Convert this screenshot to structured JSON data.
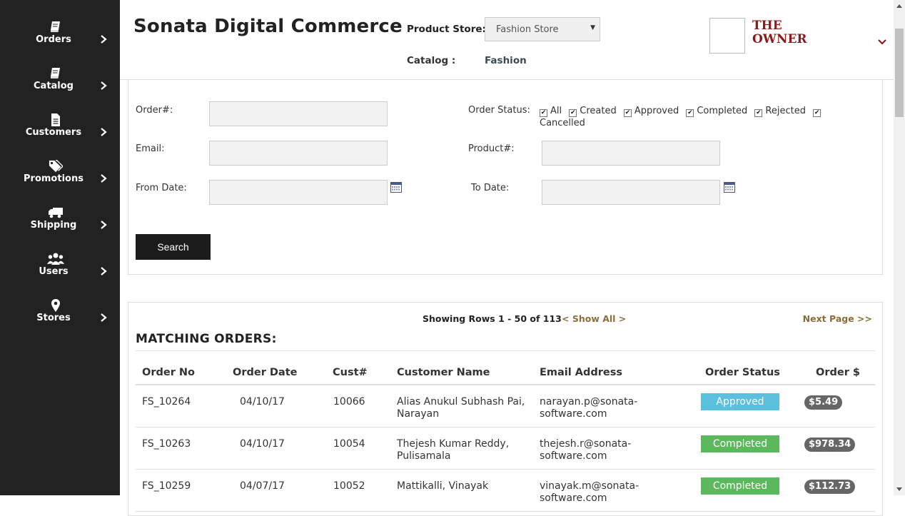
{
  "sidebar": {
    "items": [
      {
        "label": "Orders",
        "icon": "book-icon"
      },
      {
        "label": "Catalog",
        "icon": "book-icon"
      },
      {
        "label": "Customers",
        "icon": "document-icon"
      },
      {
        "label": "Promotions",
        "icon": "tags-icon"
      },
      {
        "label": "Shipping",
        "icon": "truck-icon"
      },
      {
        "label": "Users",
        "icon": "users-icon"
      },
      {
        "label": "Stores",
        "icon": "map-marker-icon"
      }
    ]
  },
  "header": {
    "brand": "Sonata Digital Commerce",
    "product_store_label": "Product Store:",
    "product_store_value": "Fashion Store",
    "catalog_label": "Catalog :",
    "catalog_value": "Fashion",
    "user_name": "THE OWNER"
  },
  "filter": {
    "order_label": "Order#:",
    "email_label": "Email:",
    "from_date_label": "From Date:",
    "order_status_label": "Order Status:",
    "product_label": "Product#:",
    "to_date_label": "To Date:",
    "statuses": [
      "All",
      "Created",
      "Approved",
      "Completed",
      "Rejected",
      "Cancelled"
    ],
    "search_label": "Search"
  },
  "orders": {
    "showing": "Showing Rows 1 - 50 of 113",
    "show_all": "< Show All >",
    "next_page": "Next Page >>",
    "title": "MATCHING ORDERS:",
    "columns": [
      "Order No",
      "Order Date",
      "Cust#",
      "Customer Name",
      "Email Address",
      "Order Status",
      "Order $"
    ],
    "rows": [
      {
        "order_no": "FS_10264",
        "date": "04/10/17",
        "cust": "10066",
        "name_1": "Alias Anukul Subhash Pai,",
        "name_2": "Narayan",
        "email_1": "narayan.p@sonata-",
        "email_2": "software.com",
        "status": "Approved",
        "amount": "$5.49"
      },
      {
        "order_no": "FS_10263",
        "date": "04/10/17",
        "cust": "10054",
        "name_1": "Thejesh Kumar Reddy,",
        "name_2": "Pulisamala",
        "email_1": "thejesh.r@sonata-",
        "email_2": "software.com",
        "status": "Completed",
        "amount": "$978.34"
      },
      {
        "order_no": "FS_10259",
        "date": "04/07/17",
        "cust": "10052",
        "name_1": "Mattikalli, Vinayak",
        "name_2": "",
        "email_1": "vinayak.m@sonata-",
        "email_2": "software.com",
        "status": "Completed",
        "amount": "$112.73"
      }
    ]
  },
  "colors": {
    "sidebar_bg": "#222222",
    "approved": "#5bc0de",
    "completed": "#5cb85c",
    "owner": "#8b1a1a",
    "link": "#8a6d3b"
  }
}
